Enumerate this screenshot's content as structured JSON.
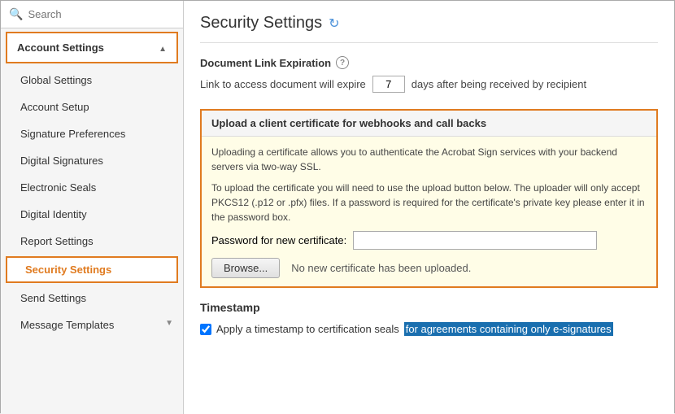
{
  "sidebar": {
    "search_placeholder": "Search",
    "account_settings_label": "Account Settings",
    "items": [
      {
        "id": "global-settings",
        "label": "Global Settings",
        "active": false
      },
      {
        "id": "account-setup",
        "label": "Account Setup",
        "active": false
      },
      {
        "id": "signature-preferences",
        "label": "Signature Preferences",
        "active": false
      },
      {
        "id": "digital-signatures",
        "label": "Digital Signatures",
        "active": false
      },
      {
        "id": "electronic-seals",
        "label": "Electronic Seals",
        "active": false
      },
      {
        "id": "digital-identity",
        "label": "Digital Identity",
        "active": false
      },
      {
        "id": "report-settings",
        "label": "Report Settings",
        "active": false
      },
      {
        "id": "security-settings",
        "label": "Security Settings",
        "active": true
      },
      {
        "id": "send-settings",
        "label": "Send Settings",
        "active": false
      },
      {
        "id": "message-templates",
        "label": "Message Templates",
        "active": false
      }
    ]
  },
  "main": {
    "title": "Security Settings",
    "refresh_icon": "↻",
    "document_link_expiration": {
      "label": "Document Link Expiration",
      "description": "Link to access document will expire",
      "days_value": "7",
      "days_suffix": "days after being received by recipient"
    },
    "cert_box": {
      "header": "Upload a client certificate for webhooks and call backs",
      "para1": "Uploading a certificate allows you to authenticate the Acrobat Sign services with your backend servers via two-way SSL.",
      "para2": "To upload the certificate you will need to use the upload button below. The uploader will only accept PKCS12 (.p12 or .pfx) files. If a password is required for the certificate's private key please enter it in the password box.",
      "password_label": "Password for new certificate:",
      "browse_label": "Browse...",
      "no_cert_text": "No new certificate has been uploaded."
    },
    "timestamp": {
      "title": "Timestamp",
      "checkbox_label_static": "Apply a timestamp to certification seals",
      "checkbox_label_highlighted": "for agreements containing only e-signatures",
      "checked": true
    }
  }
}
